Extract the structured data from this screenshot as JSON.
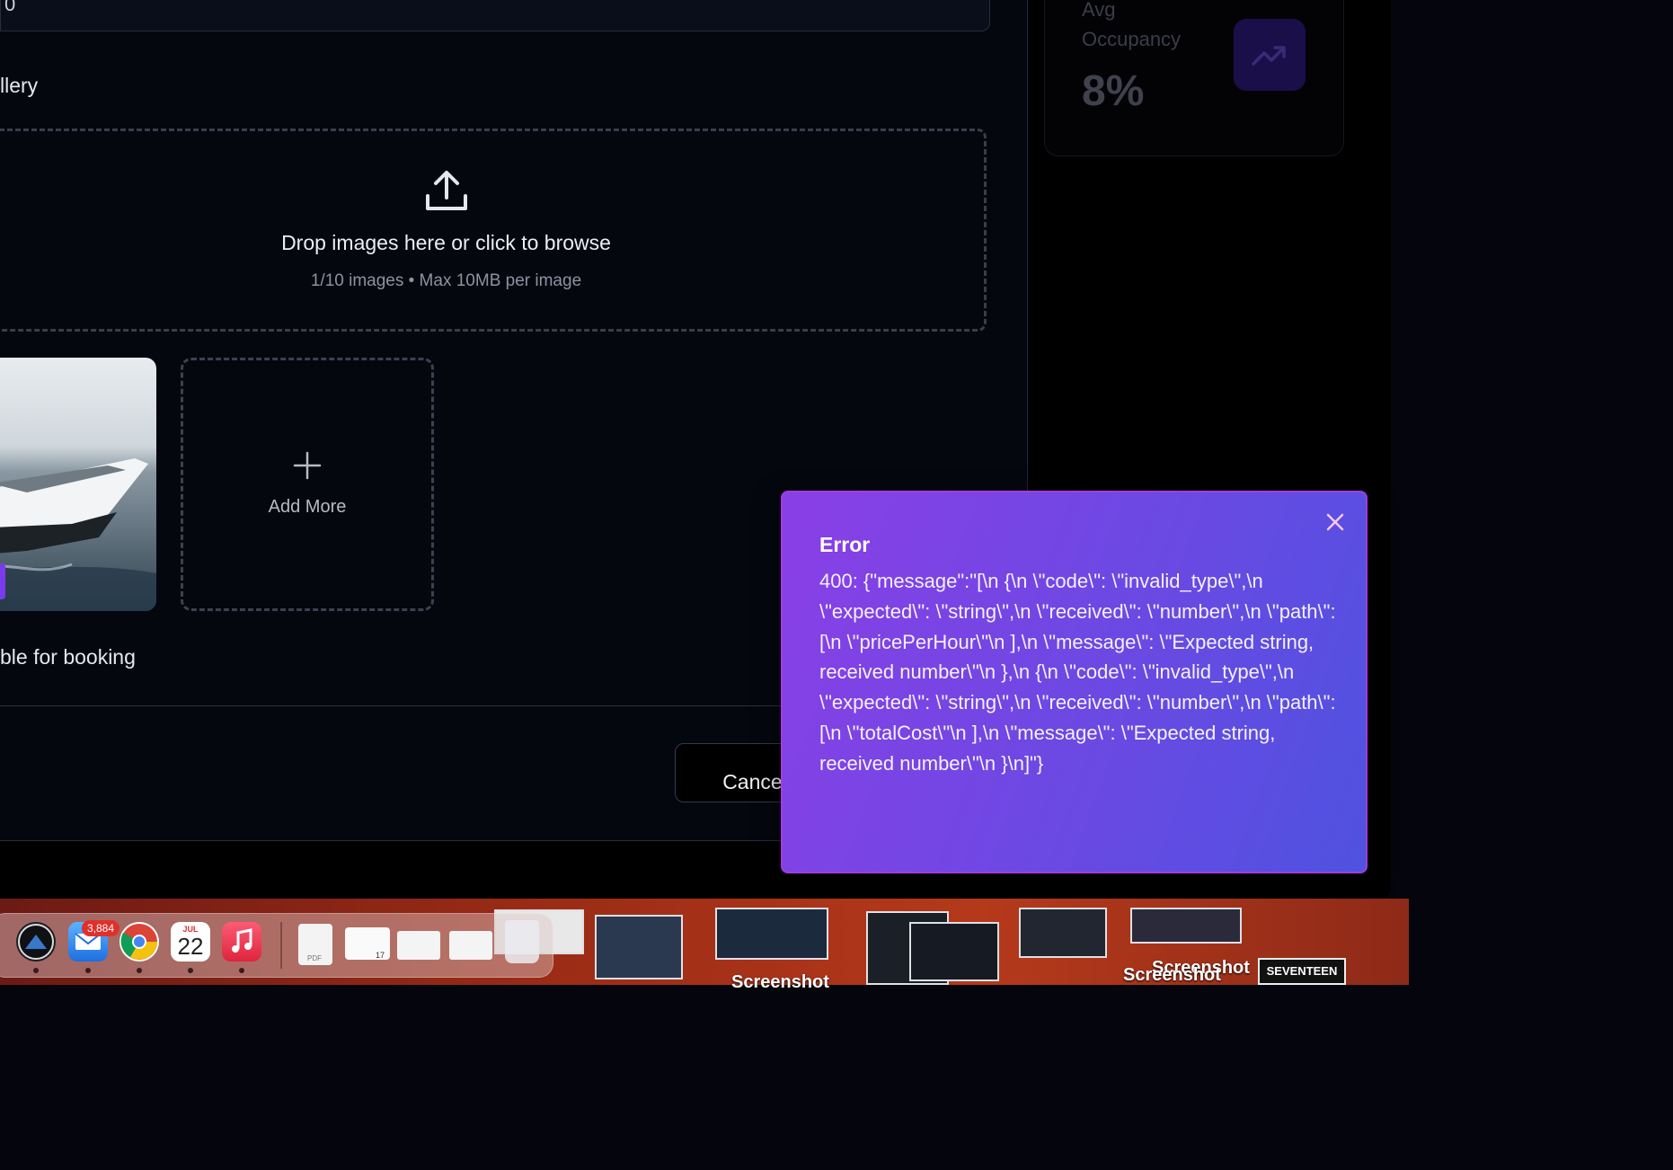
{
  "form": {
    "input_value": "0",
    "gallery_label": "llery",
    "dropzone_title": "Drop images here or click to browse",
    "dropzone_subtitle": "1/10 images • Max 10MB per image",
    "add_more_label": "Add More",
    "booking_label": "ble for booking",
    "cancel_label": "Cancel"
  },
  "stats": {
    "label": "Avg Occupancy",
    "value": "8%",
    "icon": "trending-up-icon"
  },
  "toast": {
    "title": "Error",
    "message": "400: {\"message\":\"[\\n {\\n \\\"code\\\": \\\"invalid_type\\\",\\n \\\"expected\\\": \\\"string\\\",\\n \\\"received\\\": \\\"number\\\",\\n \\\"path\\\": [\\n \\\"pricePerHour\\\"\\n ],\\n \\\"message\\\": \\\"Expected string, received number\\\"\\n },\\n {\\n \\\"code\\\": \\\"invalid_type\\\",\\n \\\"expected\\\": \\\"string\\\",\\n \\\"received\\\": \\\"number\\\",\\n \\\"path\\\": [\\n \\\"totalCost\\\"\\n ],\\n \\\"message\\\": \\\"Expected string, received number\\\"\\n }\\n]\"}",
    "accent_from": "#8a3fe6",
    "accent_to": "#4f52e0"
  },
  "dock": {
    "mail_badge": "3,884",
    "calendar_month": "JUL",
    "calendar_day": "22",
    "pdf_label": "PDF",
    "doc_day": "17"
  },
  "desktop": {
    "screenshot_label": "Screenshot",
    "screenshot_label_2": "Screenshot",
    "screenshot_label_3": "Screenshot",
    "seventeen_label": "SEVENTEEN"
  }
}
